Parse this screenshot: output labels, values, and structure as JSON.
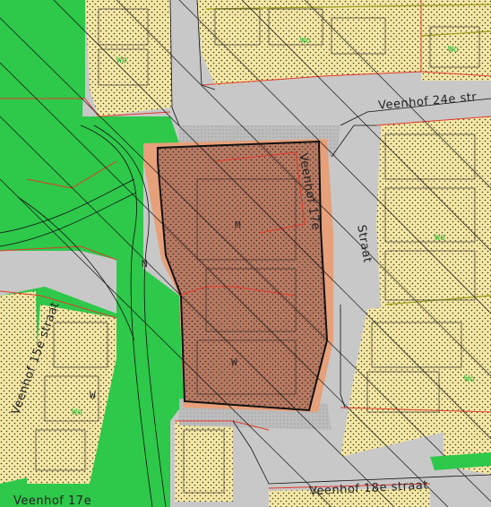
{
  "map": {
    "colors": {
      "road": "#c8c8c8",
      "green_space": "#2ec84a",
      "residential": "#f5e7a6",
      "residential_dots": "#3a3a1a",
      "building_dark": "#e8d79a",
      "highlight_parcel": "#b87a63",
      "highlight_border": "#e6a07a",
      "pavement": "#b8b8b8",
      "boundary_red": "#e23a2a",
      "boundary_olive": "#9aa01a",
      "line_black": "#111111"
    },
    "streets": {
      "veenhof_24e": "Veenhof 24e str",
      "veenhof_17e_vertical": "Veenhof 17e",
      "straat_vertical": "Straat",
      "veenhof_15e": "Veenhof 15e straat",
      "veenhof_18e": "Veenhof 18e straat",
      "veenhof_17e_bottom": "Veenhof 17e"
    },
    "labels": {
      "m": "M",
      "n": "N",
      "w_left": "W",
      "w_main": "W"
    },
    "zone_codes": {
      "top_right": "Wo",
      "top_center": "Wo",
      "right_mid": "Wo",
      "right_low": "Wo",
      "left_mid": "Wo",
      "bottom_left": "Wo"
    }
  }
}
